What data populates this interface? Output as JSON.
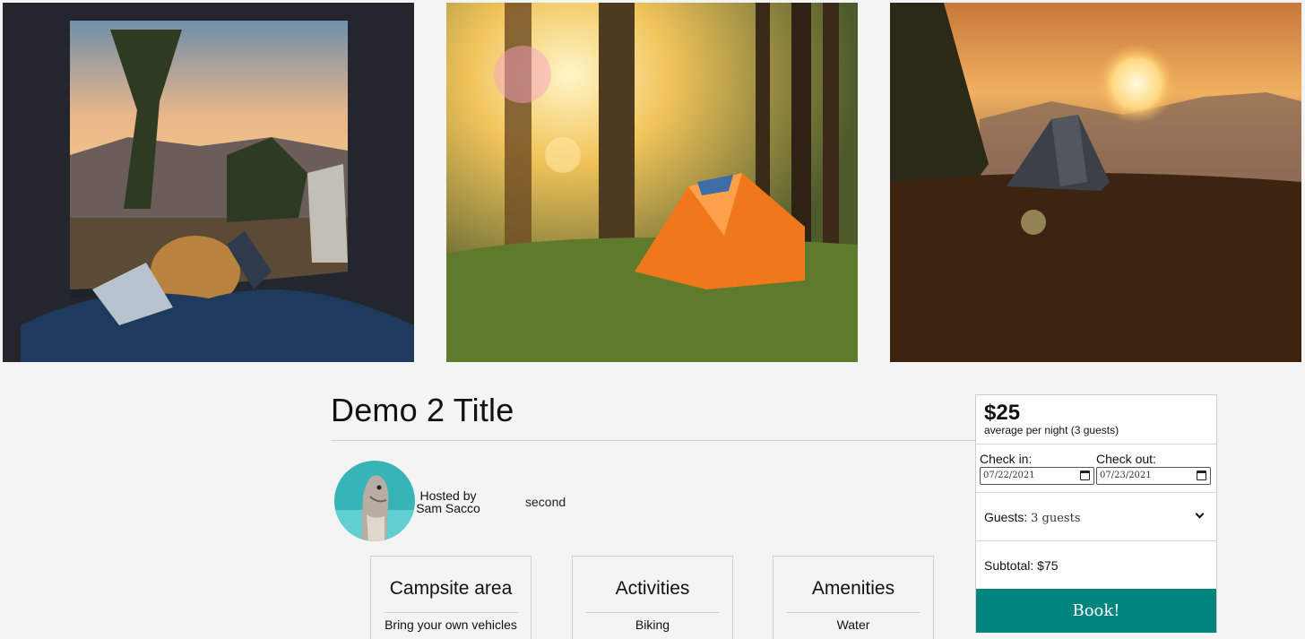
{
  "gallery": {
    "photos": [
      {
        "icon": "van-campsite-photo"
      },
      {
        "icon": "forest-tent-photo"
      },
      {
        "icon": "sunset-tent-photo"
      }
    ]
  },
  "listing": {
    "title": "Demo 2 Title",
    "host_prefix": "Hosted by",
    "host_name": "Sam Sacco",
    "second": "second"
  },
  "features": [
    {
      "heading": "Campsite area",
      "item": "Bring your own vehicles"
    },
    {
      "heading": "Activities",
      "item": "Biking"
    },
    {
      "heading": "Amenities",
      "item": "Water"
    }
  ],
  "booking": {
    "price": "$25",
    "price_note": "average per night (3 guests)",
    "checkin_label": "Check in:",
    "checkin_value": "07/22/2021",
    "checkout_label": "Check out:",
    "checkout_value": "07/23/2021",
    "guests_label": "Guests:",
    "guests_value": "3 guests",
    "subtotal": "Subtotal: $75",
    "book_label": "Book!"
  },
  "colors": {
    "accent": "#00857e",
    "background": "#f4f4f4"
  }
}
